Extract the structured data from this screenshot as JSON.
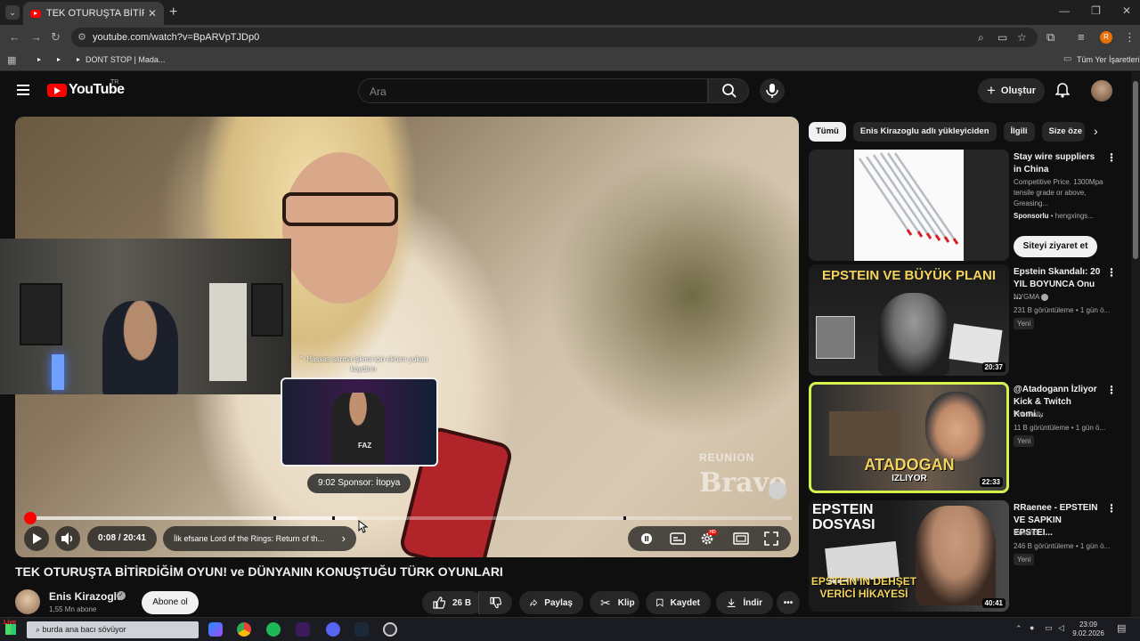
{
  "browser": {
    "tab_title": "TEK OTURUŞTA BİTİRDİĞİM OYUN",
    "url": "youtube.com/watch?v=BpARVpTJDp0",
    "profile_letter": "R",
    "bookmark_label": "DONT STOP | Mada...",
    "all_bookmarks": "Tüm Yer İşaretleri"
  },
  "header": {
    "logo_text": "YouTube",
    "region": "TR",
    "search_placeholder": "Ara",
    "create_label": "Oluştur"
  },
  "player": {
    "swipe_hint": "⌃ Hassas sarma işlemi için ekranı yukarı kaydırın",
    "preview_chip": "9:02  Sponsor: İtopya",
    "preview_sign": "FAZ",
    "time_current": "0:08",
    "time_separator": " / ",
    "time_total": "20:41",
    "chapter_label": "İlk efsane Lord of the Rings: Return of th...",
    "chapter_arrow": "›",
    "settings_badge": "HD",
    "progress_played_fraction": 0.006,
    "progress_hover_fraction": 0.43,
    "watermark_top": "REUNION",
    "watermark_bottom": "Bravo"
  },
  "video": {
    "title": "TEK OTURUŞTA BİTİRDİĞİM OYUN! ve DÜNYANIN KONUŞTUĞU TÜRK OYUNLARI",
    "channel": "Enis Kirazoglu",
    "subscribers": "1,55 Mn abone",
    "subscribe_label": "Abone ol",
    "likes": "26 B",
    "share": "Paylaş",
    "clip": "Klip",
    "save": "Kaydet",
    "download": "İndir"
  },
  "sidebar": {
    "chips": [
      "Tümü",
      "Enis Kirazoglu adlı yükleyiciden",
      "İlgili",
      "Size öze"
    ],
    "recommendations": [
      {
        "title": "Stay wire suppliers in China",
        "desc": "Competitive Price. 1300Mpa tensile grade or above, Greasing...",
        "sponsor": "Sponsorlu",
        "sponsor_domain": " • hengxings...",
        "cta": "Siteyi ziyaret et"
      },
      {
        "title": "Epstein Skandalı: 20 YIL BOYUNCA Onu ...",
        "channel": "NYGMA",
        "meta": "231 B görüntüleme • 1 gün ö...",
        "badge": "Yeni",
        "duration": "20:37",
        "thumb_text": "EPSTEIN VE BÜYÜK PLANI"
      },
      {
        "title": "@Atadogann İzliyor Kick & Twitch Komi...",
        "channel": "The Pally",
        "meta": "11 B görüntüleme • 1 gün ö...",
        "badge": "Yeni",
        "duration": "22:33",
        "thumb_text": "ATADOGAN",
        "thumb_sub": "IZLIYOR"
      },
      {
        "title": "RRaenee - EPSTEIN VE SAPKIN EPSTEI...",
        "channel": "Rolland",
        "meta": "246 B görüntüleme • 1 gün ö...",
        "badge": "Yeni",
        "duration": "40:41",
        "thumb_text": "EPSTEIN DOSYASI",
        "thumb_bottom": "EPSTEIN'IN DEHŞET VERİCİ HİKAYESİ"
      }
    ]
  },
  "taskbar": {
    "search_text": "burda ana bacı sövüyor",
    "live_label": "Live",
    "time": "23:09",
    "date": "9.02.2026"
  },
  "colors": {
    "accent_red": "#ff0000",
    "page_bg": "#0f0f0f",
    "chip_bg": "#272727"
  }
}
